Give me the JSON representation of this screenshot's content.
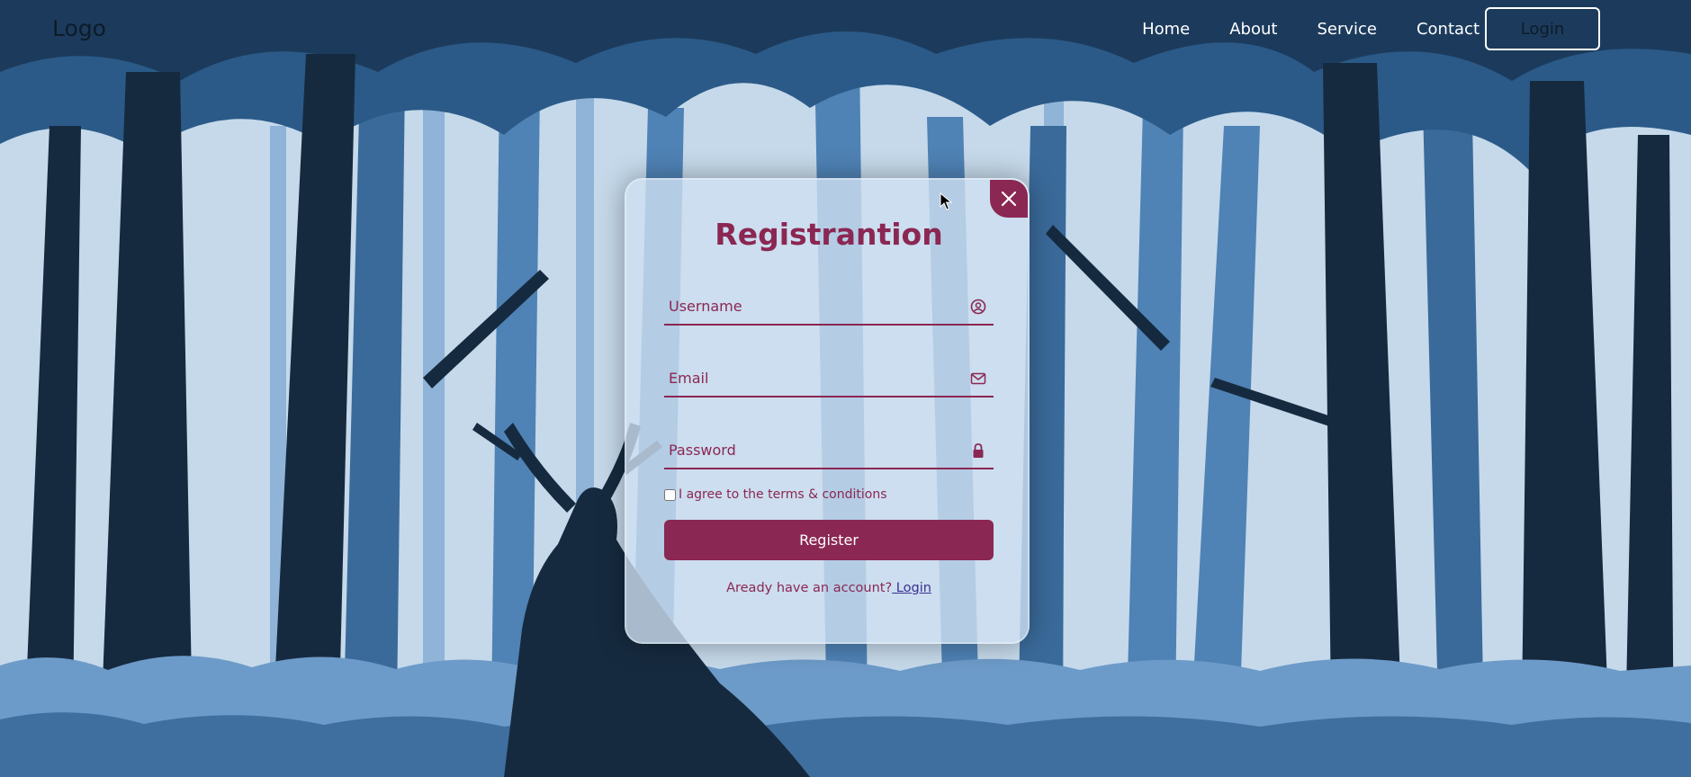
{
  "header": {
    "logo": "Logo",
    "nav": [
      "Home",
      "About",
      "Service",
      "Contact"
    ],
    "login_button": "Login"
  },
  "modal": {
    "title": "Registrantion",
    "fields": {
      "username_placeholder": "Username",
      "email_placeholder": "Email",
      "password_placeholder": "Password"
    },
    "icons": {
      "username": "user-circle-icon",
      "email": "mail-icon",
      "password": "lock-icon",
      "close": "close-icon"
    },
    "terms_label": "I agree to the terms & conditions",
    "terms_checked": false,
    "register_button": "Register",
    "footer_text": "Aready have an account?",
    "footer_link": " Login"
  },
  "colors": {
    "accent": "#8b2753",
    "navy": "#162a3f",
    "sky": "#c5d9ea",
    "tree_mid": "#2f5f8c",
    "tree_light": "#4f82b5"
  }
}
